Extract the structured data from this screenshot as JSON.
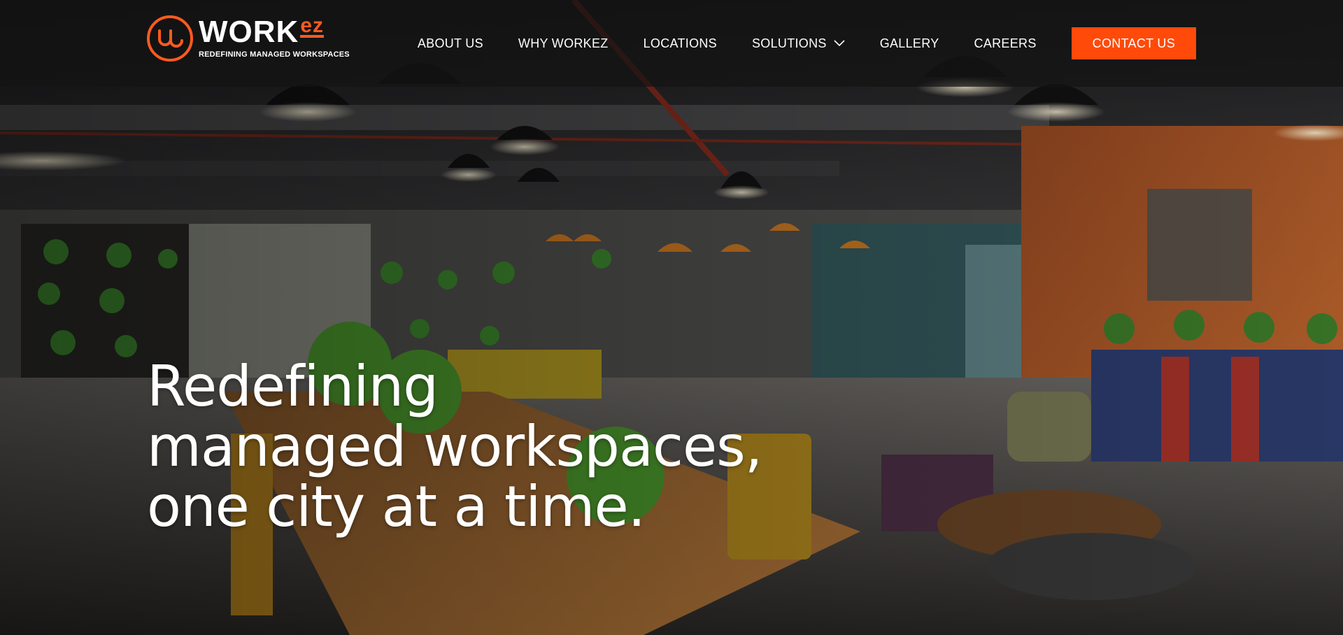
{
  "brand": {
    "name_main": "WORK",
    "name_accent": "ez",
    "tagline": "REDEFINING MANAGED WORKSPACES",
    "accent_color": "#ff5a1f"
  },
  "nav": {
    "items": [
      {
        "label": "ABOUT US"
      },
      {
        "label": "WHY WORKEZ"
      },
      {
        "label": "LOCATIONS"
      },
      {
        "label": "SOLUTIONS",
        "has_dropdown": true,
        "icon": "chevron-down-icon"
      },
      {
        "label": "GALLERY"
      },
      {
        "label": "CAREERS"
      }
    ],
    "cta_label": "CONTACT US",
    "cta_color": "#ff4a0a"
  },
  "hero": {
    "headline_lines": [
      "Redefining",
      "managed workspaces,",
      "one city at a time."
    ],
    "background": "office-interior-photo"
  }
}
